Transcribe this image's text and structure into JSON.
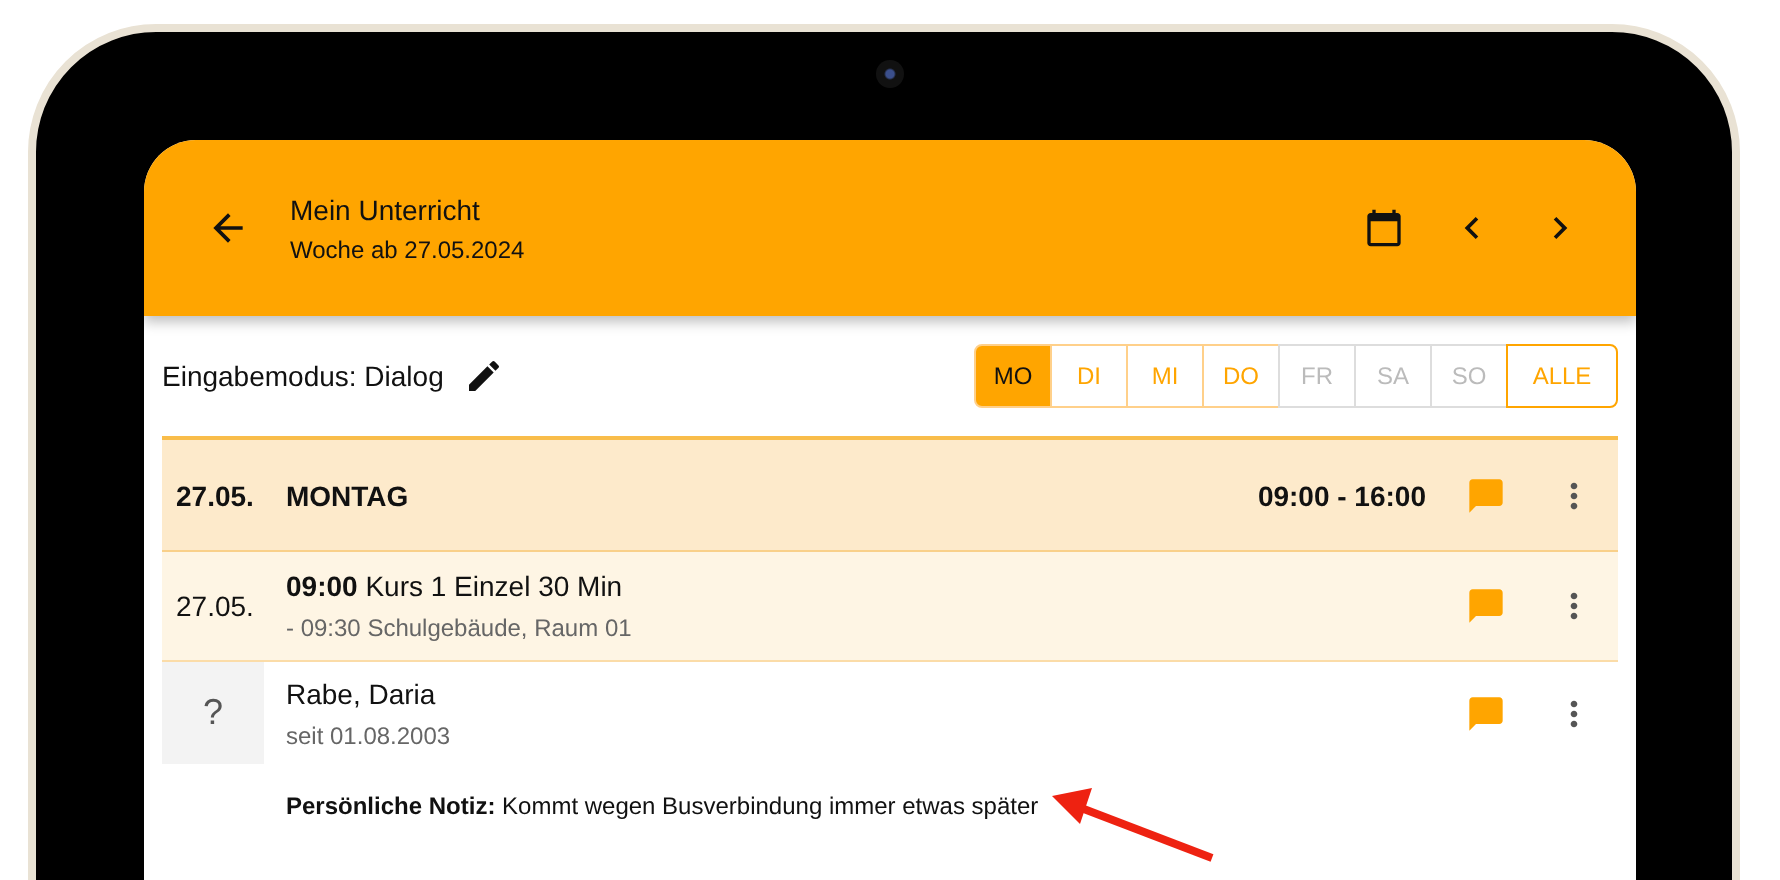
{
  "app_bar": {
    "title": "Mein Unterricht",
    "subtitle": "Woche ab 27.05.2024"
  },
  "input_mode": {
    "label": "Eingabemodus: Dialog"
  },
  "days": [
    {
      "label": "MO",
      "selected": true,
      "disabled": false
    },
    {
      "label": "DI",
      "selected": false,
      "disabled": false
    },
    {
      "label": "MI",
      "selected": false,
      "disabled": false
    },
    {
      "label": "DO",
      "selected": false,
      "disabled": false
    },
    {
      "label": "FR",
      "selected": false,
      "disabled": true
    },
    {
      "label": "SA",
      "selected": false,
      "disabled": true
    },
    {
      "label": "SO",
      "selected": false,
      "disabled": true
    }
  ],
  "all_button": {
    "label": "ALLE"
  },
  "day_header": {
    "date": "27.05.",
    "weekday": "MONTAG",
    "hours": "09:00 - 16:00"
  },
  "lesson": {
    "date": "27.05.",
    "title": "**09:00** Kurs 1 Einzel 30 Min",
    "detail": "- 09:30 Schulgebäude, Raum 01"
  },
  "student": {
    "avatar": "?",
    "name": "Rabe, Daria",
    "since": "seit 01.08.2003",
    "note": "**Persönliche Notiz:** Kommt wegen Busverbindung immer etwas später"
  }
}
